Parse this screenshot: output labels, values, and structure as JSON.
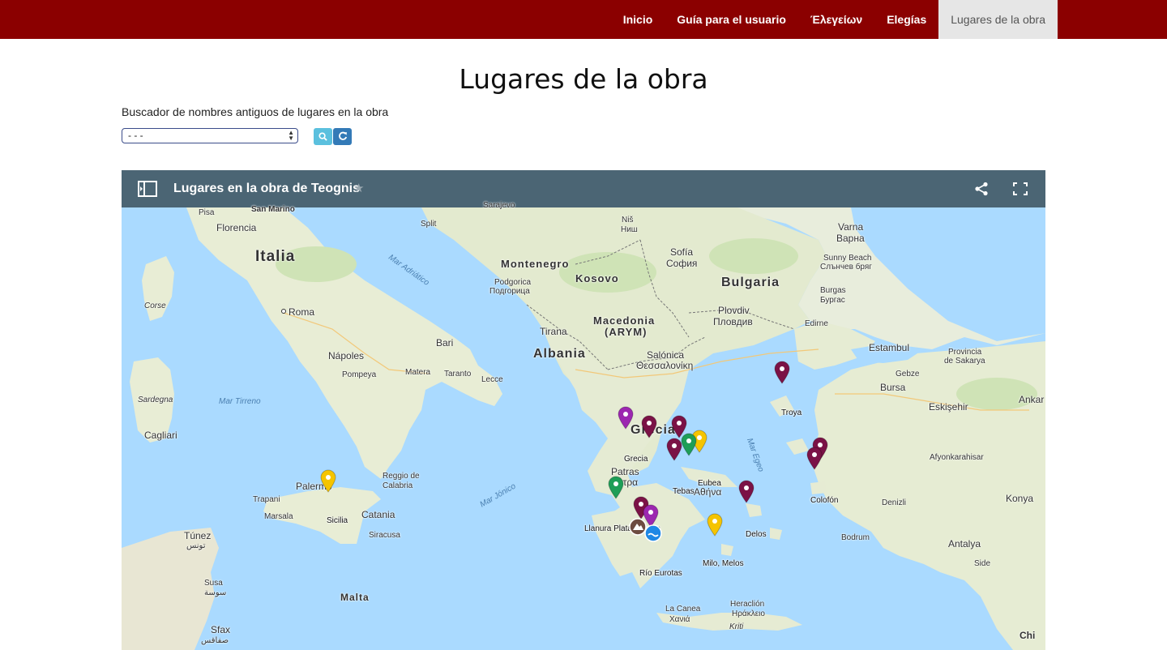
{
  "nav": {
    "items": [
      {
        "label": "Inicio"
      },
      {
        "label": "Guía para el usuario"
      },
      {
        "label": "Έλεγείων"
      },
      {
        "label": "Elegías"
      },
      {
        "label": "Lugares de la obra"
      }
    ]
  },
  "page": {
    "title": "Lugares de la obra",
    "search_label": "Buscador de nombres antiguos de lugares en la obra",
    "select_value": "- - -"
  },
  "map": {
    "title": "Lugares en la obra de Teognis",
    "countries": {
      "italia": "Italia",
      "albania": "Albania",
      "bulgaria": "Bulgaria",
      "grecia": "Grecia",
      "montenegro": "Montenegro",
      "kosovo": "Kosovo",
      "macedonia": "Macedonia",
      "macedonia_sub": "(ARYM)",
      "malta": "Malta"
    },
    "seas": {
      "adriatico": "Mar Adriático",
      "tirreno": "Mar Tirreno",
      "jonico": "Mar Jónico",
      "egeo": "Mar Egeo"
    },
    "cities": {
      "pisa": "Pisa",
      "florencia": "Florencia",
      "san_marino": "San Marino",
      "roma": "Roma",
      "napoles": "Nápoles",
      "pompeya": "Pompeya",
      "bari": "Bari",
      "matera": "Matera",
      "taranto": "Taranto",
      "lecce": "Lecce",
      "corse": "Corse",
      "sardegna": "Sardegna",
      "cagliari": "Cagliari",
      "palermo": "Palermo",
      "trapani": "Trapani",
      "marsala": "Marsala",
      "catania": "Catania",
      "siracusa": "Siracusa",
      "reggio": "Reggio de",
      "calabria": "Calabria",
      "tunez": "Túnez",
      "tunez_ar": "تونس",
      "susa": "Susa",
      "susa_ar": "سوسة",
      "sfax": "Sfax",
      "sfax_ar": "صفاقس",
      "split": "Split",
      "sarajevo": "Sarajevo",
      "nis": "Niš",
      "nis_cyr": "Ниш",
      "podgorica": "Podgorica",
      "podgorica_cyr": "Подгорица",
      "tirana": "Tirana",
      "sofia": "Sofía",
      "sofia_cyr": "София",
      "plovdiv": "Plovdiv",
      "plovdiv_cyr": "Пловдив",
      "varna": "Varna",
      "varna_cyr": "Варна",
      "sunny_beach": "Sunny Beach",
      "sunny_beach_cyr": "Слънчев бряг",
      "burgas": "Burgas",
      "burgas_cyr": "Бургас",
      "edirne": "Edirne",
      "salonica": "Salónica",
      "salonica_gr": "Θεσσαλονίκη",
      "estambul": "Estambul",
      "sakarya": "Provincia",
      "sakarya2": "de Sakarya",
      "gebze": "Gebze",
      "bursa": "Bursa",
      "eskisehir": "Eskişehir",
      "ankara": "Ankar",
      "afyon": "Afyonkarahisar",
      "konya": "Konya",
      "denizli": "Denizli",
      "antalya": "Antalya",
      "bodrum": "Bodrum",
      "side": "Side",
      "patras": "Patras",
      "patras_gr": "Πάτρα",
      "atenas_gr": "Αθήνα",
      "la_canea": "La Canea",
      "la_canea_gr": "Χανιά",
      "heraclion": "Heraclión",
      "heraclion_gr": "Ηράκλειο",
      "kriti": "Kriti",
      "chi": "Chi"
    },
    "places": {
      "grecia": "Grecia",
      "troya": "Troya",
      "eubea": "Eubea",
      "tebas": "Tebas",
      "colofon": "Colofón",
      "delos": "Delos",
      "sicilia": "Sicilia",
      "llanura": "Llanura Platanistunte",
      "eurotas": "Río Eurotas",
      "milo": "Milo, Melos"
    },
    "pin_colors": {
      "maroon": "#7b1246",
      "purple": "#9c27b0",
      "green": "#1e9e57",
      "yellow": "#f5c400",
      "brown": "#6d4c41",
      "blue": "#1e88e5"
    }
  }
}
